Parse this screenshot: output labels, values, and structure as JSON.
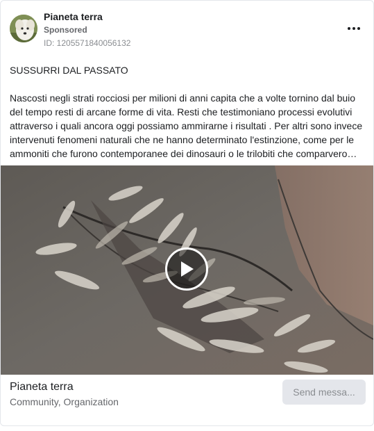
{
  "header": {
    "page_name": "Pianeta terra",
    "sponsored_label": "Sponsored",
    "ad_id": "ID: 1205571840056132"
  },
  "post": {
    "title": "SUSSURRI DAL PASSATO",
    "body": "Nascosti negli strati rocciosi per milioni di anni capita che a volte tornino dal buio del tempo resti di arcane forme di vita. Resti che testimoniano processi evolutivi attraverso i quali ancora oggi possiamo ammirarne i risultati . Per altri sono invece intervenuti fenomeni naturali che ne hanno determinato l'estinzione, come per le ammoniti che furono contemporanee dei dinosauri o le trilobiti che comparvero…"
  },
  "media": {
    "type": "video",
    "subject": "fossil-in-rock"
  },
  "footer": {
    "page_name": "Pianeta terra",
    "category": "Community, Organization",
    "cta_label": "Send messa..."
  },
  "icons": {
    "more": "more-options-icon",
    "play": "play-icon"
  }
}
